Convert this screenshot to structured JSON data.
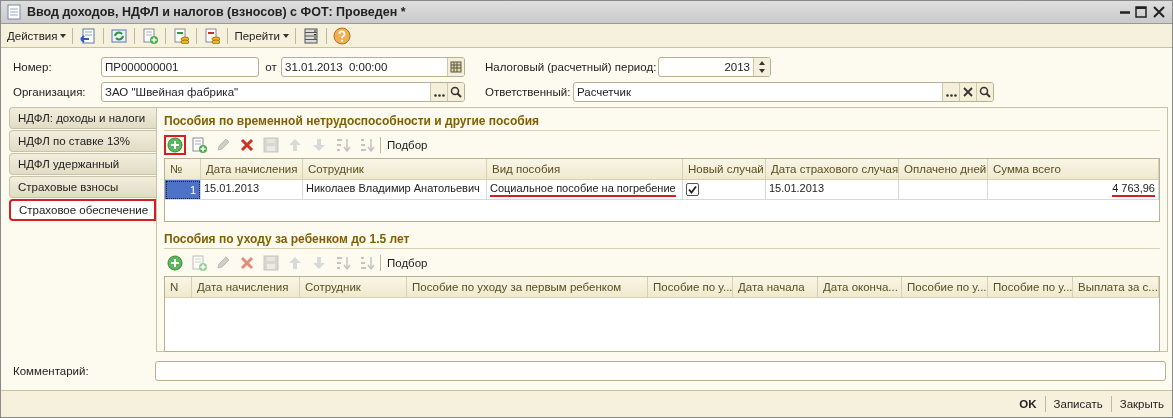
{
  "window": {
    "title": "Ввод доходов, НДФЛ и налогов (взносов) с ФОТ: Проведен *"
  },
  "toolbar": [
    {
      "kind": "menu",
      "label": "Действия"
    },
    {
      "kind": "post"
    },
    {
      "kind": "refresh"
    },
    {
      "kind": "copy"
    },
    {
      "kind": "coins-in"
    },
    {
      "kind": "coins-out"
    },
    {
      "kind": "menu",
      "label": "Перейти"
    },
    {
      "kind": "list"
    },
    {
      "kind": "help"
    }
  ],
  "header": {
    "number_label": "Номер:",
    "number": "ПР000000001",
    "date_label": "от",
    "date": "31.01.2013  0:00:00",
    "period_label": "Налоговый (расчетный) период:",
    "period": "2013",
    "org_label": "Организация:",
    "org": "ЗАО \"Швейная фабрика\"",
    "resp_label": "Ответственный:",
    "resp": "Расчетчик"
  },
  "tabs": [
    {
      "label": "НДФЛ: доходы и налоги",
      "selected": false,
      "highlighted": false
    },
    {
      "label": "НДФЛ по ставке 13%",
      "selected": false,
      "highlighted": false
    },
    {
      "label": "НДФЛ удержанный",
      "selected": false,
      "highlighted": false
    },
    {
      "label": "Страховые взносы",
      "selected": false,
      "highlighted": false
    },
    {
      "label": "Страховое обеспечение",
      "selected": true,
      "highlighted": true
    }
  ],
  "sections": [
    {
      "title": "Пособия по временной нетрудоспособности и другие пособия",
      "pick_label": "Подбор",
      "toolbar": [
        {
          "kind": "add",
          "disabled": false,
          "highlighted": true
        },
        {
          "kind": "copy",
          "disabled": false,
          "highlighted": false
        },
        {
          "kind": "edit",
          "disabled": true,
          "highlighted": false
        },
        {
          "kind": "delete",
          "disabled": false,
          "highlighted": false
        },
        {
          "kind": "save",
          "disabled": true,
          "highlighted": false
        },
        {
          "kind": "up",
          "disabled": true,
          "highlighted": false
        },
        {
          "kind": "down",
          "disabled": true,
          "highlighted": false
        },
        {
          "kind": "sort-asc",
          "disabled": true,
          "highlighted": false
        },
        {
          "kind": "sort-desc",
          "disabled": true,
          "highlighted": false
        }
      ],
      "columns": [
        "№",
        "Дата начисления",
        "Сотрудник",
        "Вид пособия",
        "Новый случай",
        "Дата страхового случая",
        "Оплачено дней",
        "Сумма всего"
      ],
      "rows": [
        {
          "selected": true,
          "cells": [
            {
              "kind": "number",
              "text": "1"
            },
            {
              "kind": "text",
              "text": "15.01.2013"
            },
            {
              "kind": "text",
              "text": "Николаев Владимир Анатольевич"
            },
            {
              "kind": "text",
              "text": "Социальное пособие на погребение",
              "underlined": true
            },
            {
              "kind": "checkbox",
              "checked": true
            },
            {
              "kind": "text",
              "text": "15.01.2013"
            },
            {
              "kind": "empty"
            },
            {
              "kind": "amount",
              "text": "4 763,96",
              "underlined": true
            }
          ]
        }
      ]
    },
    {
      "title": "Пособия по уходу за ребенком до 1.5 лет",
      "pick_label": "Подбор",
      "toolbar": [
        {
          "kind": "add",
          "disabled": false,
          "highlighted": false
        },
        {
          "kind": "copy",
          "disabled": true,
          "highlighted": false
        },
        {
          "kind": "edit",
          "disabled": true,
          "highlighted": false
        },
        {
          "kind": "delete",
          "disabled": true,
          "highlighted": false
        },
        {
          "kind": "save",
          "disabled": true,
          "highlighted": false
        },
        {
          "kind": "up",
          "disabled": true,
          "highlighted": false
        },
        {
          "kind": "down",
          "disabled": true,
          "highlighted": false
        },
        {
          "kind": "sort-asc",
          "disabled": true,
          "highlighted": false
        },
        {
          "kind": "sort-desc",
          "disabled": true,
          "highlighted": false
        }
      ],
      "columns": [
        "N",
        "Дата начисления",
        "Сотрудник",
        "Пособие по уходу за первым ребенком",
        "Пособие по у...",
        "Дата начала",
        "Дата оконча...",
        "Пособие по у...",
        "Пособие по у...",
        "Выплата за с..."
      ]
    }
  ],
  "comment": {
    "label": "Комментарий:"
  },
  "footer": {
    "buttons": [
      {
        "label": "OK",
        "default": true
      },
      {
        "label": "Записать",
        "default": false
      },
      {
        "label": "Закрыть",
        "default": false
      }
    ]
  }
}
